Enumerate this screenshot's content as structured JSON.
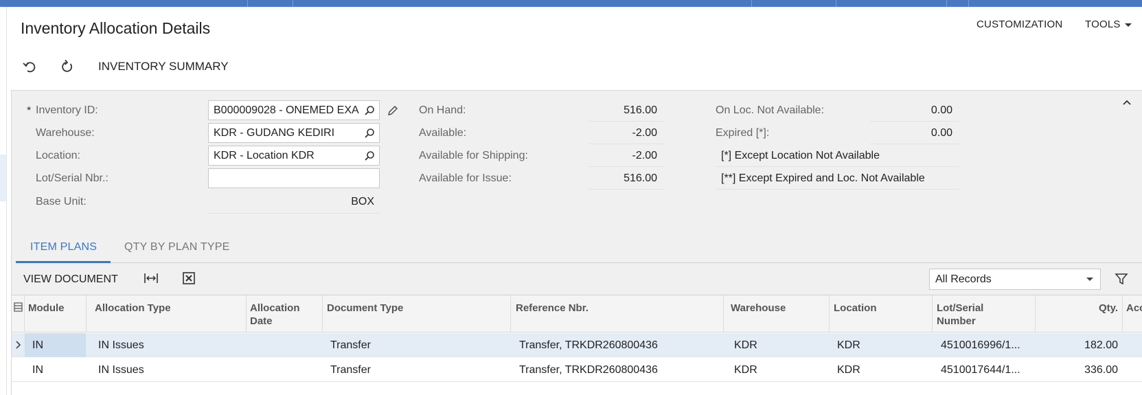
{
  "app": {
    "page_title": "Inventory Allocation Details",
    "customization_label": "CUSTOMIZATION",
    "tools_label": "TOOLS"
  },
  "toolbar": {
    "undo_icon": "undo-icon",
    "refresh_icon": "refresh-icon",
    "inventory_summary_label": "INVENTORY SUMMARY"
  },
  "form": {
    "required_mark": "*",
    "inventory_id_label": "Inventory ID:",
    "inventory_id_value": "B000009028 - ONEMED EXA",
    "warehouse_label": "Warehouse:",
    "warehouse_value": "KDR - GUDANG KEDIRI",
    "location_label": "Location:",
    "location_value": "KDR - Location KDR",
    "lot_serial_label": "Lot/Serial Nbr.:",
    "lot_serial_value": "",
    "base_unit_label": "Base Unit:",
    "base_unit_value": "BOX"
  },
  "summary": {
    "on_hand_label": "On Hand:",
    "on_hand_value": "516.00",
    "available_label": "Available:",
    "available_value": "-2.00",
    "available_shipping_label": "Available for Shipping:",
    "available_shipping_value": "-2.00",
    "available_issue_label": "Available for Issue:",
    "available_issue_value": "516.00",
    "on_loc_not_available_label": "On Loc. Not Available:",
    "on_loc_not_available_value": "0.00",
    "expired_label": "Expired [*]:",
    "expired_value": "0.00",
    "note_1": "[*]  Except Location Not Available",
    "note_2": "[**] Except Expired and  Loc. Not Available"
  },
  "tabs": [
    {
      "label": "ITEM PLANS",
      "active": true
    },
    {
      "label": "QTY BY PLAN TYPE",
      "active": false
    }
  ],
  "grid_toolbar": {
    "view_document_label": "VIEW DOCUMENT",
    "fit_columns_icon": "fit-columns-icon",
    "export_excel_icon": "excel-export-icon",
    "records_filter_value": "All Records",
    "filter_icon": "filter-icon"
  },
  "grid": {
    "columns": [
      {
        "key": "module",
        "label": "Module"
      },
      {
        "key": "allocation_type",
        "label": "Allocation Type"
      },
      {
        "key": "allocation_date",
        "label": "Allocation\nDate"
      },
      {
        "key": "document_type",
        "label": "Document Type"
      },
      {
        "key": "reference_nbr",
        "label": "Reference Nbr."
      },
      {
        "key": "warehouse",
        "label": "Warehouse"
      },
      {
        "key": "location",
        "label": "Location"
      },
      {
        "key": "lot_serial",
        "label": "Lot/Serial\nNumber"
      },
      {
        "key": "qty",
        "label": "Qty."
      },
      {
        "key": "acc",
        "label": "Acc"
      }
    ],
    "rows": [
      {
        "module": "IN",
        "allocation_type": "IN Issues",
        "allocation_date": "",
        "document_type": "Transfer",
        "reference_nbr": "Transfer, TRKDR260800436",
        "warehouse": "KDR",
        "location": "KDR",
        "lot_serial": "4510016996/1...",
        "qty": "182.00",
        "selected": true
      },
      {
        "module": "IN",
        "allocation_type": "IN Issues",
        "allocation_date": "",
        "document_type": "Transfer",
        "reference_nbr": "Transfer, TRKDR260800436",
        "warehouse": "KDR",
        "location": "KDR",
        "lot_serial": "4510017644/1...",
        "qty": "336.00",
        "selected": false
      }
    ]
  },
  "colors": {
    "topbar": "#4a78c2",
    "accent": "#3a77c4",
    "panel_bg": "#f0f0f0",
    "selected_row": "#e4ecf6"
  }
}
